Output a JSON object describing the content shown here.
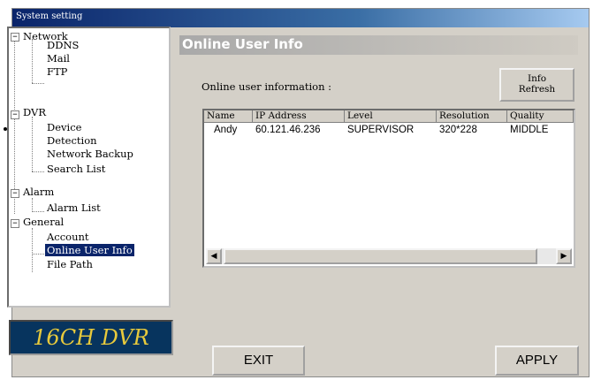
{
  "window": {
    "title": "System setting"
  },
  "tree": {
    "network": "Network",
    "ddns": "DDNS",
    "mail": "Mail",
    "ftp": "FTP",
    "dvr": "DVR",
    "device": "Device",
    "detection": "Detection",
    "network_backup": "Network Backup",
    "search_list": "Search List",
    "alarm": "Alarm",
    "alarm_list": "Alarm List",
    "general": "General",
    "account": "Account",
    "online_user_info": "Online User Info",
    "file_path": "File Path",
    "expander_symbol": "−"
  },
  "logo": {
    "text": "16CH DVR"
  },
  "panel": {
    "heading": "Online User Info",
    "online_label": "Online user information :",
    "refresh_line1": "Info",
    "refresh_line2": "Refresh"
  },
  "table": {
    "columns": [
      "Name",
      "IP Address",
      "Level",
      "Resolution",
      "Quality"
    ],
    "rows": [
      [
        "Andy",
        "60.121.46.236",
        "SUPERVISOR",
        "320*228",
        "MIDDLE"
      ]
    ]
  },
  "scroll": {
    "left_arrow": "◀",
    "right_arrow": "▶"
  },
  "buttons": {
    "exit": "EXIT",
    "apply": "APPLY"
  }
}
